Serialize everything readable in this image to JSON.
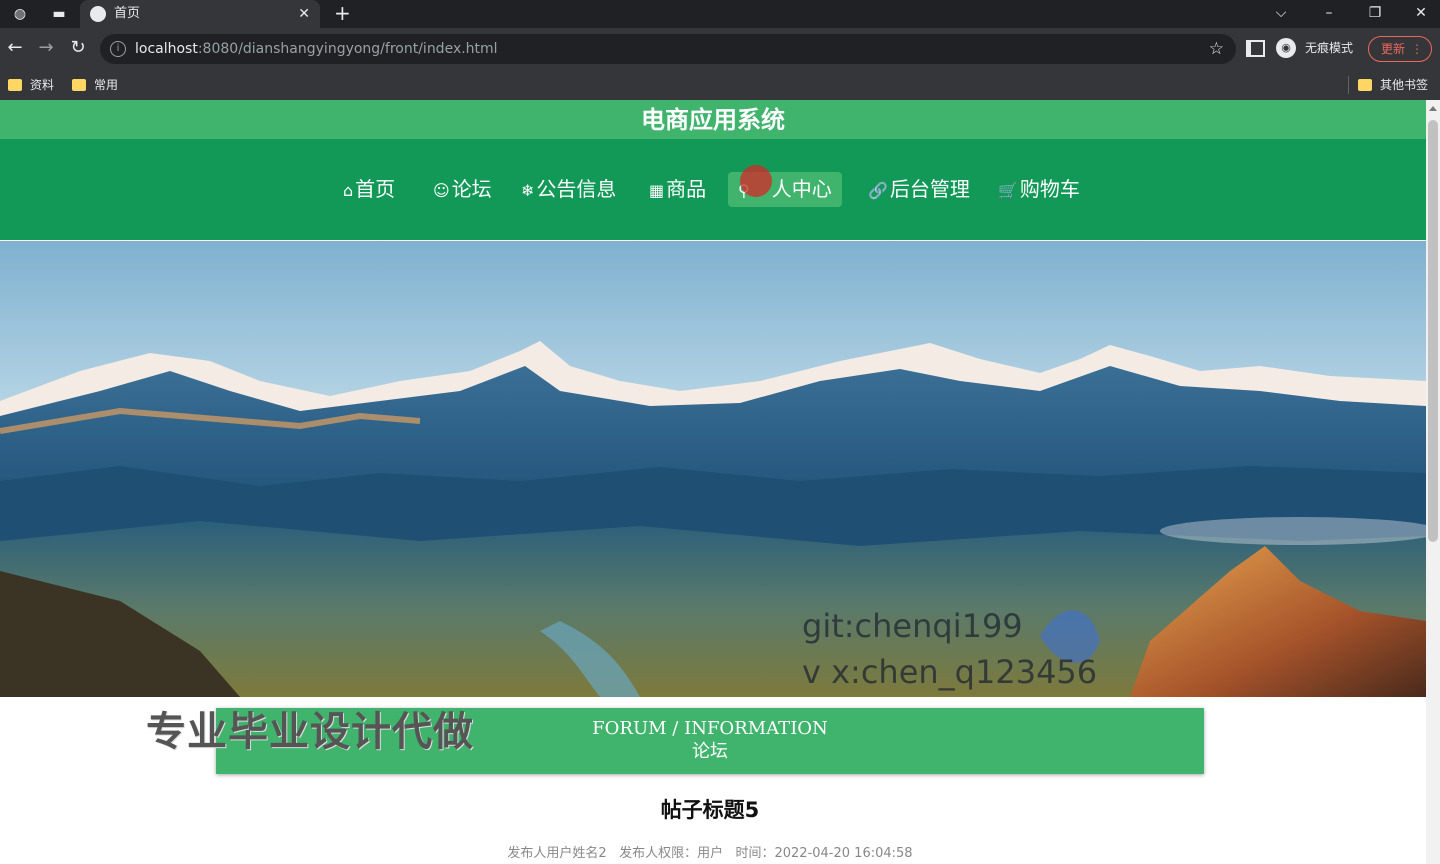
{
  "browser": {
    "tab_title": "首页",
    "url_host": "localhost",
    "url_rest": ":8080/dianshangyingyong/front/index.html",
    "incognito_label": "无痕模式",
    "update_label": "更新",
    "bookmarks": [
      "资料",
      "常用"
    ],
    "other_bookmarks": "其他书签"
  },
  "site": {
    "title": "电商应用系统",
    "nav": [
      {
        "icon": "⌂",
        "label": "首页"
      },
      {
        "icon": "☺",
        "label": "论坛"
      },
      {
        "icon": "❄",
        "label": "公告信息"
      },
      {
        "icon": "▦",
        "label": "商品"
      },
      {
        "icon": "⚲",
        "label": "人中心"
      },
      {
        "icon": "🔗",
        "label": "后台管理"
      },
      {
        "icon": "🛒",
        "label": "购物车"
      }
    ],
    "active_nav": 4
  },
  "banner": {
    "watermark_line1": "git:chenqi199",
    "watermark_line2": "v x:chen_q123456",
    "slides": 3,
    "active_slide": 0
  },
  "overlay_text": "专业毕业设计代做",
  "section": {
    "title_en": "FORUM / INFORMATION",
    "title_cn": "论坛"
  },
  "post": {
    "title": "帖子标题5",
    "meta": "发布人用户姓名2   发布人权限：用户   时间：2022-04-20 16:04:58"
  },
  "colors": {
    "title_bar": "#40b36d",
    "nav_bar": "#129957",
    "accent": "#40b36d"
  }
}
